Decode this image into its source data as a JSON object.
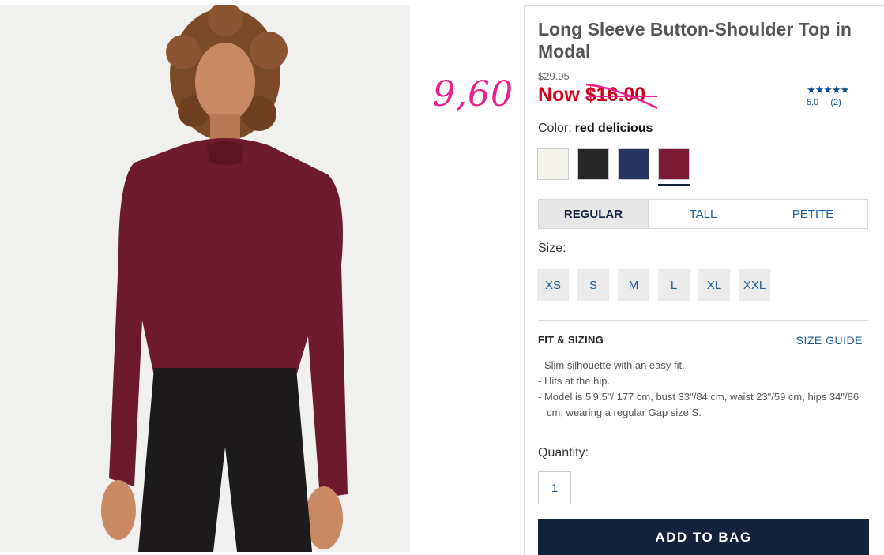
{
  "product": {
    "title": "Long Sleeve Button-Shoulder Top in Modal",
    "original_price": "$29.95",
    "now_label": "Now",
    "sale_price": "$16.00",
    "image_alt": "Model wearing long sleeve button-shoulder top"
  },
  "annotation": {
    "text": "9,60",
    "color": "#ea1f8c"
  },
  "rating": {
    "stars": "★★★★★",
    "score": "5.0",
    "count": "(2)"
  },
  "color": {
    "label": "Color:",
    "selected": "red delicious",
    "swatches": [
      {
        "name": "white",
        "hex": "#f3f2ec"
      },
      {
        "name": "black",
        "hex": "#262626"
      },
      {
        "name": "navy",
        "hex": "#27325e"
      },
      {
        "name": "red delicious",
        "hex": "#7e1a35"
      }
    ]
  },
  "fit": {
    "tabs": [
      "REGULAR",
      "TALL",
      "PETITE"
    ],
    "active": "REGULAR"
  },
  "size": {
    "label": "Size:",
    "options": [
      "XS",
      "S",
      "M",
      "L",
      "XL",
      "XXL"
    ]
  },
  "fit_sizing": {
    "heading": "FIT & SIZING",
    "guide_label": "SIZE GUIDE",
    "details": [
      "Slim silhouette with an easy fit.",
      "Hits at the hip.",
      "Model is 5'9.5\"/ 177 cm, bust 33\"/84 cm, waist 23\"/59 cm, hips 34\"/86 cm, wearing a regular Gap size S."
    ]
  },
  "quantity": {
    "label": "Quantity:",
    "value": "1"
  },
  "cta": {
    "add_to_bag": "ADD TO BAG"
  },
  "colors": {
    "accent": "#13233d",
    "sale": "#d0021b",
    "link": "#1d5c95"
  }
}
